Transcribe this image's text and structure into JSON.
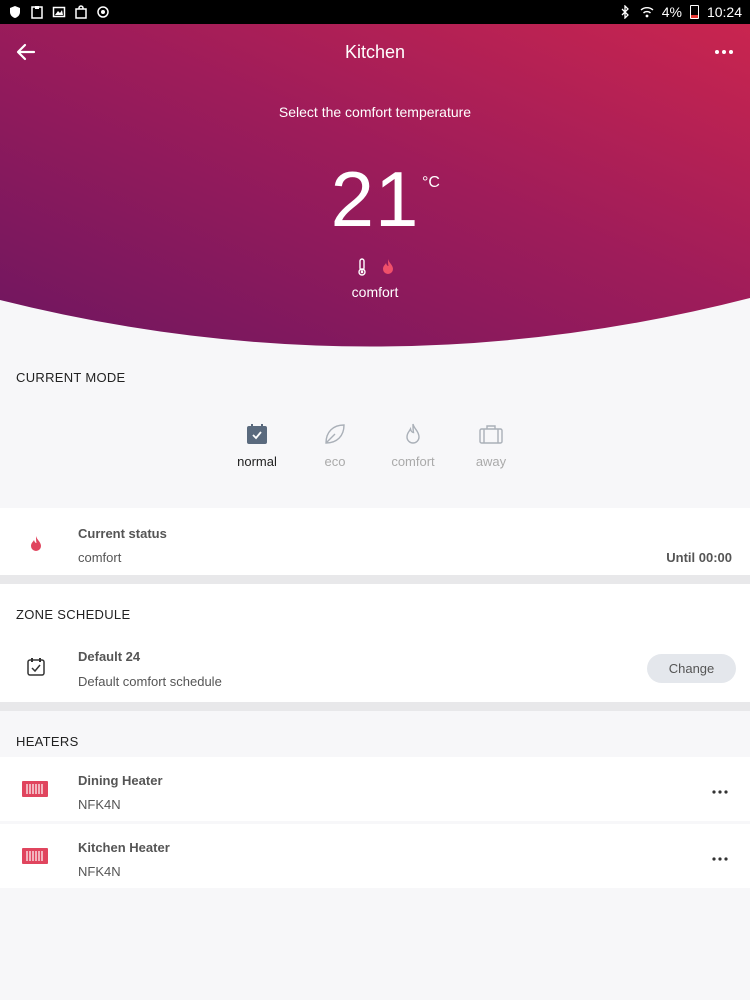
{
  "status_bar": {
    "battery": "4%",
    "time": "10:24"
  },
  "header": {
    "title": "Kitchen",
    "subtitle": "Select the comfort temperature",
    "temperature": "21",
    "unit": "°C",
    "mode": "comfort"
  },
  "current_mode": {
    "heading": "CURRENT MODE",
    "modes": [
      {
        "label": "normal",
        "icon": "calendar-check-icon",
        "active": true
      },
      {
        "label": "eco",
        "icon": "leaf-icon",
        "active": false
      },
      {
        "label": "comfort",
        "icon": "flame-icon",
        "active": false
      },
      {
        "label": "away",
        "icon": "suitcase-icon",
        "active": false
      }
    ]
  },
  "current_status": {
    "title": "Current status",
    "value": "comfort",
    "until": "Until 00:00"
  },
  "zone_schedule": {
    "heading": "ZONE SCHEDULE",
    "name": "Default 24",
    "description": "Default comfort schedule",
    "change_label": "Change"
  },
  "heaters": {
    "heading": "HEATERS",
    "items": [
      {
        "name": "Dining Heater",
        "model": "NFK4N"
      },
      {
        "name": "Kitchen Heater",
        "model": "NFK4N"
      }
    ]
  },
  "colors": {
    "accent": "#e0455e",
    "header_gradient_start": "#7b1a5e",
    "header_gradient_end": "#c2234f"
  }
}
